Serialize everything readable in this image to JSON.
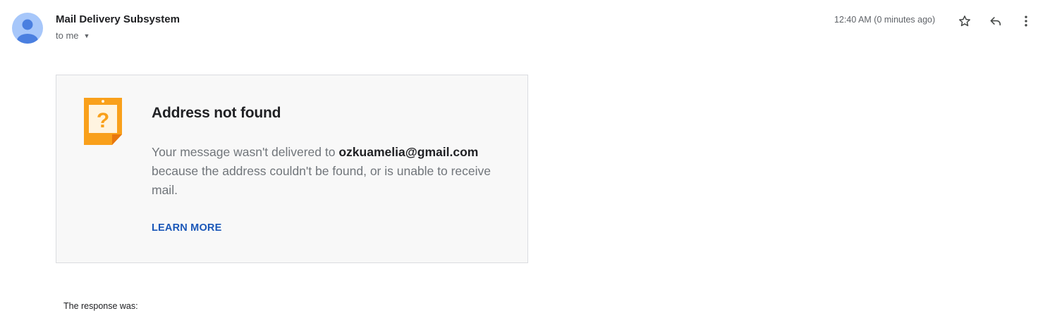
{
  "header": {
    "sender_name": "Mail Delivery Subsystem",
    "recipient_label": "to me",
    "timestamp": "12:40 AM (0 minutes ago)",
    "icons": {
      "avatar": "person-avatar-icon",
      "recipient_details": "caret-down-icon",
      "star": "star-outline-icon",
      "reply": "reply-arrow-icon",
      "more": "more-vertical-icon"
    }
  },
  "bounce_card": {
    "icon": "question-note-warning-icon",
    "title": "Address not found",
    "message_prefix": "Your message wasn't delivered to ",
    "recipient_email": "ozkuamelia@gmail.com",
    "message_suffix": " because the address couldn't be found, or is unable to receive mail.",
    "learn_more_label": "LEARN MORE"
  },
  "body": {
    "response_label": "The response was:"
  },
  "colors": {
    "avatar_bg": "#a7c7fa",
    "avatar_fg": "#4a7fe0",
    "warning_orange": "#f9a01b",
    "link_blue": "#1a57b8",
    "card_bg": "#f8f8f8"
  }
}
